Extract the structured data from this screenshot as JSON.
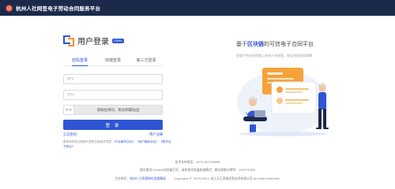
{
  "header": {
    "title": "杭州人社网签电子劳动合同服务平台"
  },
  "brand": {
    "title": "用户登录",
    "badge": "CDMA"
  },
  "tabs": [
    {
      "label": "密码登录",
      "active": true
    },
    {
      "label": "快捷登录",
      "active": false
    },
    {
      "label": "第三方登录",
      "active": false
    }
  ],
  "form": {
    "account_placeholder": "账号",
    "password_placeholder": "密码",
    "slider_handle": ">>",
    "slider_text": "请按住滑块，拖动到最右边",
    "login_label": "登 录"
  },
  "links": {
    "forgot": "忘记密码",
    "register": "用户注册"
  },
  "agreement": {
    "prefix": "登录或完成注册即代表您已阅读并同意",
    "platform_agreement": "《平台服务协议》",
    "user_privacy": "《用户隐私协议》",
    "digital_cert": "《数字证书协议》"
  },
  "hero": {
    "slogan_prefix": "基于",
    "slogan_highlight": "区块链",
    "slogan_suffix": "的可信电子合同平台",
    "subtitle": "签电子劳动合同就上杭州人社网签，安全合规合同保障"
  },
  "footer": {
    "support": "技术支持电话：0571-87254669",
    "browser": "建议使用Chrome浏览器打开，或其他浏览器极速模式；建议屏幕分辨率：1920*1080",
    "host_label": "主办单位：",
    "host": "杭州人力资源和社会保障局",
    "copyright": "Copyright © 2019-2021 浙江天正思维信息技术有限公司 All right reserved."
  },
  "colors": {
    "primary": "#2f55d4",
    "topbar": "#1b2a4a",
    "accent_orange": "#f09226",
    "logo_red": "#d73a2f"
  },
  "icons": {
    "logo": "emblem-icon",
    "illustration": "people-with-laptop-and-charts"
  }
}
